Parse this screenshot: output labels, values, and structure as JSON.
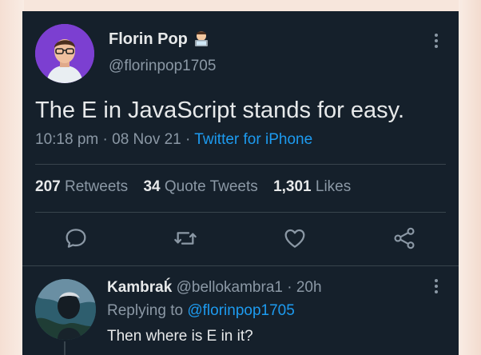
{
  "tweet": {
    "author_name": "Florin Pop",
    "author_handle": "@florinpop1705",
    "text": "The E in JavaScript stands for easy.",
    "time": "10:18 pm",
    "date": "08 Nov 21",
    "source": "Twitter for iPhone",
    "retweets_count": "207",
    "retweets_label": "Retweets",
    "quotes_count": "34",
    "quotes_label": "Quote Tweets",
    "likes_count": "1,301",
    "likes_label": "Likes"
  },
  "actions": [
    "reply-icon",
    "retweet-icon",
    "like-icon",
    "share-icon"
  ],
  "reply": {
    "author_name": "Kambraḱ",
    "author_handle": "@bellokambra1",
    "time": "20h",
    "replying_prefix": "Replying to",
    "replying_to": "@florinpop1705",
    "text": "Then where is E in it?"
  },
  "colors": {
    "background": "#15202b",
    "text": "#e7e9ea",
    "muted": "#8b98a5",
    "accent": "#1d9bf0",
    "divider": "#38444d"
  }
}
